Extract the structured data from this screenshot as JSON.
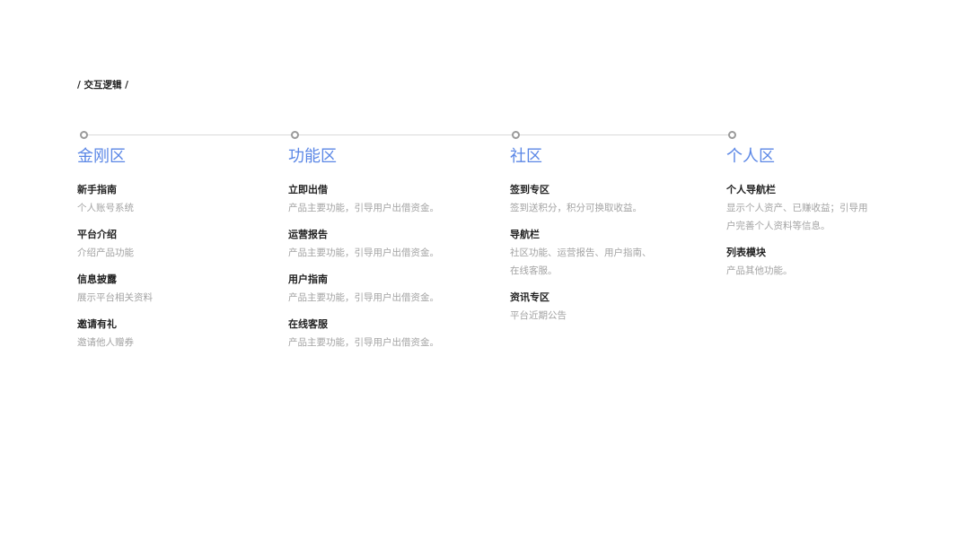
{
  "page_title": "/ 交互逻辑 /",
  "columns": [
    {
      "title": "金刚区",
      "items": [
        {
          "title": "新手指南",
          "desc": [
            "个人账号系统"
          ]
        },
        {
          "title": "平台介绍",
          "desc": [
            "介绍产品功能"
          ]
        },
        {
          "title": "信息披露",
          "desc": [
            "展示平台相关资料"
          ]
        },
        {
          "title": "邀请有礼",
          "desc": [
            "邀请他人赠券"
          ]
        }
      ]
    },
    {
      "title": "功能区",
      "items": [
        {
          "title": "立即出借",
          "desc": [
            "产品主要功能，引导用户出借资金。"
          ]
        },
        {
          "title": "运营报告",
          "desc": [
            "产品主要功能，引导用户出借资金。"
          ]
        },
        {
          "title": "用户指南",
          "desc": [
            "产品主要功能，引导用户出借资金。"
          ]
        },
        {
          "title": "在线客服",
          "desc": [
            "产品主要功能，引导用户出借资金。"
          ]
        }
      ]
    },
    {
      "title": "社区",
      "items": [
        {
          "title": "签到专区",
          "desc": [
            "签到送积分，积分可换取收益。"
          ]
        },
        {
          "title": "导航栏",
          "desc": [
            "社区功能、运营报告、用户指南、",
            "在线客服。"
          ]
        },
        {
          "title": "资讯专区",
          "desc": [
            "平台近期公告"
          ]
        }
      ]
    },
    {
      "title": "个人区",
      "items": [
        {
          "title": "个人导航栏",
          "desc": [
            "显示个人资产、已赚收益；引导用",
            "户完善个人资料等信息。"
          ]
        },
        {
          "title": "列表模块",
          "desc": [
            "产品其他功能。"
          ]
        }
      ]
    }
  ]
}
